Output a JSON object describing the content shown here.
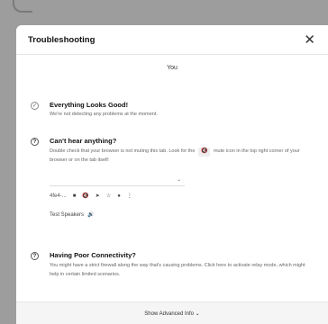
{
  "dialog": {
    "title": "Troubleshooting",
    "close_icon": "close-icon",
    "subtitle": "You"
  },
  "sections": {
    "good": {
      "icon": "check-circle-icon",
      "title": "Everything Looks Good!",
      "text": "We're not detecting any problems at the moment."
    },
    "hear": {
      "icon": "help-circle-icon",
      "title": "Can't hear anything?",
      "text_pre": "Double check that your browser is not muting this tab. Look for the",
      "mute_symbol": "🔇",
      "text_post": "mute icon in the top right corner of your browser or on the tab itself:",
      "tab_label": "4fe4-...",
      "test_speakers": "Test Speakers"
    },
    "connectivity": {
      "icon": "help-circle-icon",
      "title": "Having Poor Connectivity?",
      "text": "You might have a strict firewall along the way that's causing problems. Click here to activate relay mode, which might help in certain limited scenarios."
    }
  },
  "footer": {
    "label": "Show Advanced Info ⌄"
  }
}
